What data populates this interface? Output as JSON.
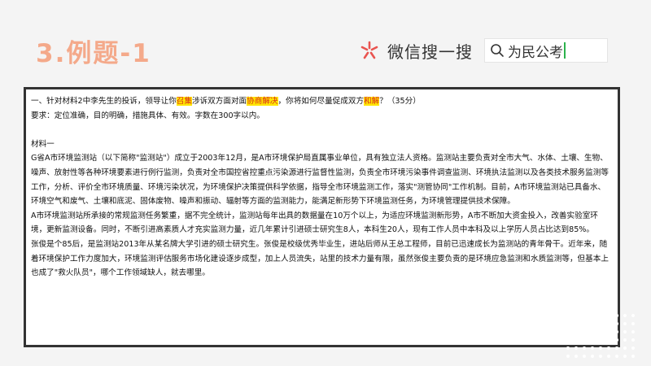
{
  "slide_title": "3.例题-1",
  "wechat": {
    "label": "微信搜一搜",
    "search_text": "为民公考",
    "accent_color": "#e95450",
    "cursor_color": "#2bb24c"
  },
  "question": {
    "parts": [
      {
        "text": "一、针对材料2中李先生的投诉，领导让你",
        "hl": false
      },
      {
        "text": "召集",
        "hl": true
      },
      {
        "text": "涉诉双方面对面",
        "hl": false
      },
      {
        "text": "协商解决",
        "hl": true
      },
      {
        "text": "，你将如何尽量促成双方",
        "hl": false
      },
      {
        "text": "和解",
        "hl": true
      },
      {
        "text": "？（35分）",
        "hl": false
      }
    ],
    "requirement": "要求：定位准确，目的明确，措施具体、有效。字数在300字以内。"
  },
  "material": {
    "heading": "材料一",
    "paragraphs": [
      "G省A市环境监测站（以下简称\"监测站\"）成立于2003年12月，是A市环境保护局直属事业单位，具有独立法人资格。监测站主要负责对全市大气、水体、土壤、生物、噪声、放射性等各种环境要素进行例行监测，负责对全市国控省控重点污染源进行监督性监测，负责全市环境污染事件调查监测、环境执法监测以及各类技术服务监测等工作，分析、评价全市环境质量、环境污染状况，为环境保护决策提供科学依据，指导全市环境监测工作，落实\"测管协同\"工作机制。目前，A市环境监测站已具备水、环境空气和废气、土壤和底泥、固体废物、噪声和振动、辐射等方面的监测能力，能满足新形势下环境监测任务，为环境管理提供技术保障。",
      "A市环境监测站所承接的常规监测任务繁重，据不完全统计，监测站每年出具的数据量在10万个以上，为适应环境监测新形势，A市不断加大资金投入，改善实验室环境，更新监测设备。同时，不断引进高素质人才充实监测力量，近几年累计引进硕士研究生8人，本科生20人，现有工作人员中本科及以上学历人员占比达到85%。",
      "张俊是个85后，是监测站2013年从某名牌大学引进的硕士研究生。张俊是校级优秀毕业生，进站后师从王总工程师，目前已迅速成长为监测站的青年骨干。近年来，随着环境保护工作力度加大，环境监测评估服务市场化建设逐步成型，加上人员流失，站里的技术力量有限，虽然张俊主要负责的是环境应急监测和水质监测等，但基本上也成了\"救火队员\"，哪个工作领域缺人，就去哪里。"
    ]
  },
  "colors": {
    "title": "#f4a98a",
    "highlight_bg": "#ffe600",
    "highlight_fg": "#d92b1e",
    "border": "#333333"
  }
}
